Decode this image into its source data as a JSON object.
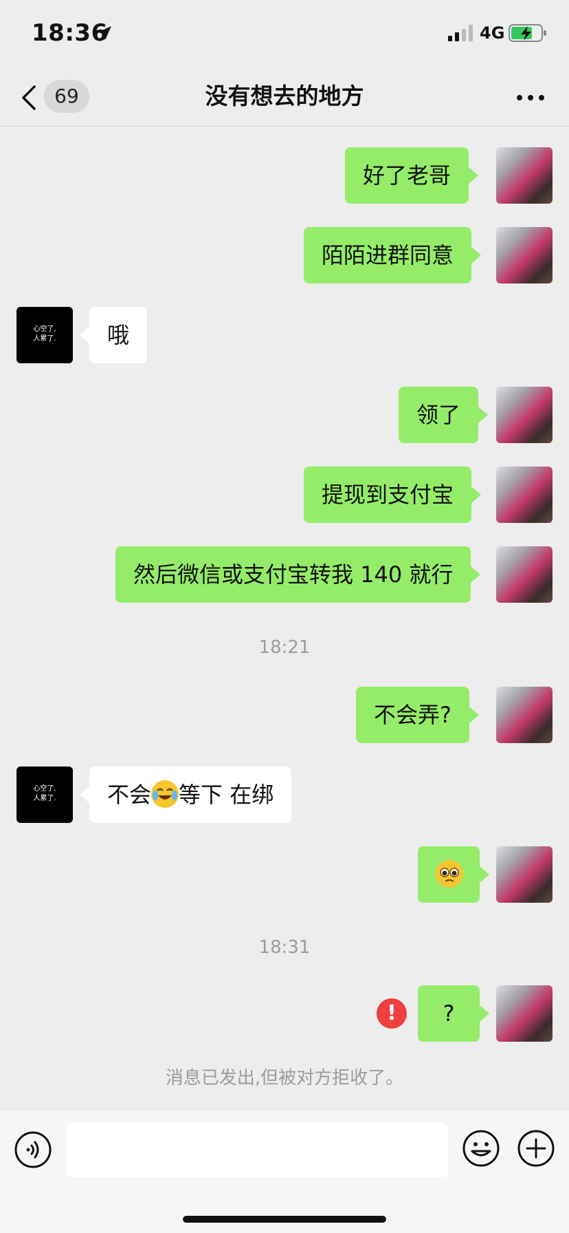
{
  "status_bar": {
    "time": "18:36",
    "network": "4G"
  },
  "nav": {
    "unread_count": "69",
    "title": "没有想去的地方"
  },
  "avatar_other_text": [
    "心空了,",
    "人累了."
  ],
  "messages": [
    {
      "from": "me",
      "text": "好了老哥"
    },
    {
      "from": "me",
      "text": "陌陌进群同意"
    },
    {
      "from": "other",
      "text": "哦"
    },
    {
      "from": "me",
      "text": "领了"
    },
    {
      "from": "me",
      "text": "提现到支付宝"
    },
    {
      "from": "me",
      "text": "然后微信或支付宝转我 140 就行"
    },
    {
      "from": "time",
      "text": "18:21"
    },
    {
      "from": "me",
      "text": "不会弄?"
    },
    {
      "from": "other",
      "text_before": "不会",
      "emoji": "face-with-tears-of-joy",
      "text_after": "等下 在绑"
    },
    {
      "from": "me",
      "emoji": "pleading-face"
    },
    {
      "from": "time",
      "text": "18:31"
    },
    {
      "from": "me",
      "text": "?",
      "status": "failed"
    }
  ],
  "system_note": "消息已发出,但被对方拒收了。",
  "input": {
    "placeholder": ""
  },
  "colors": {
    "bubble_me": "#95ec69",
    "bubble_other": "#ffffff",
    "background": "#ededed",
    "fail": "#f03f3f"
  },
  "icons": [
    "location-arrow-icon",
    "signal-icon",
    "battery-charging-icon",
    "back-chevron-icon",
    "more-icon",
    "voice-icon",
    "emoji-icon",
    "plus-icon",
    "fail-icon"
  ]
}
